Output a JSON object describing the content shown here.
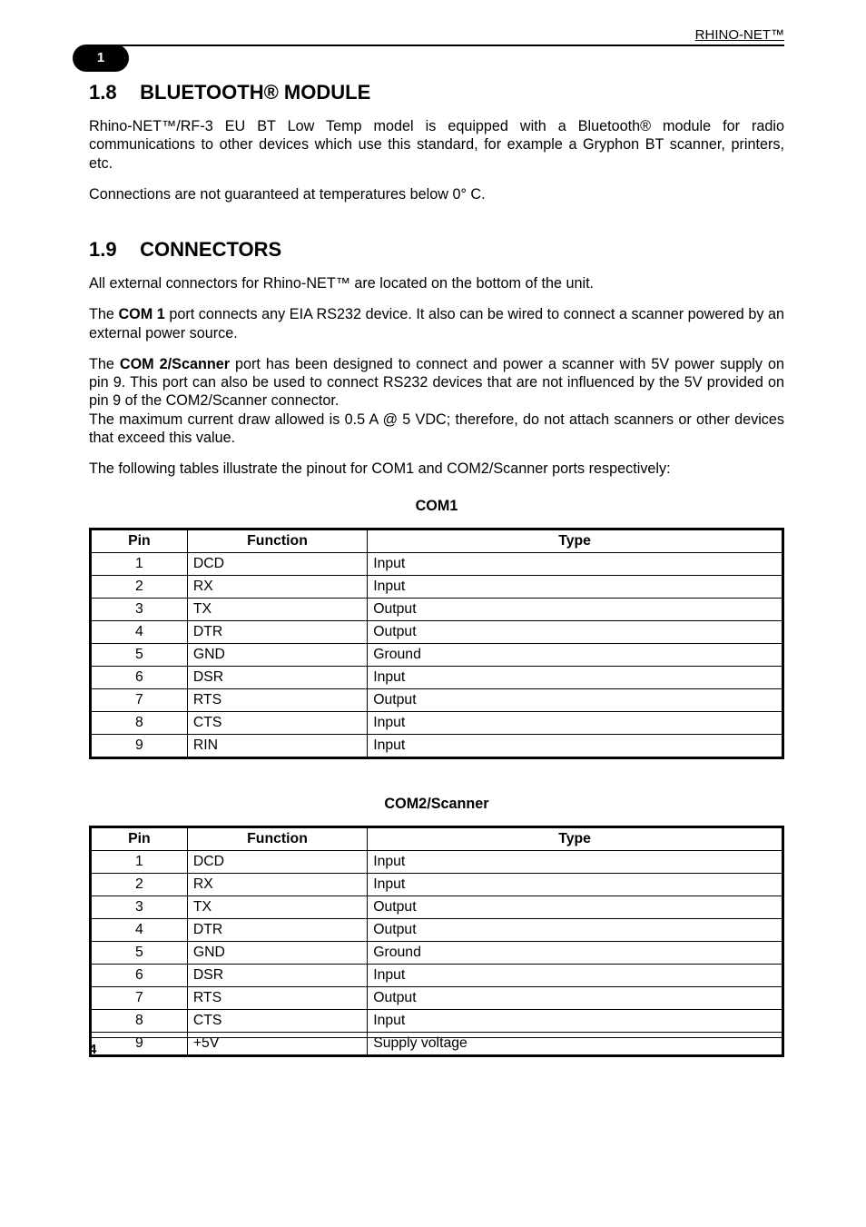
{
  "header": {
    "product": "RHINO-NET™",
    "chapter_badge": "1"
  },
  "sections": {
    "bluetooth": {
      "num": "1.8",
      "title": "BLUETOOTH® MODULE",
      "p1": "Rhino-NET™/RF-3 EU BT Low Temp model is equipped with a Bluetooth® module for radio communications to other devices which use this standard, for example a Gryphon BT scanner, printers, etc.",
      "p2": "Connections are not guaranteed at temperatures below 0° C."
    },
    "connectors": {
      "num": "1.9",
      "title": "CONNECTORS",
      "p1": "All external connectors for Rhino-NET™ are located on the bottom of the unit.",
      "p2a": "The ",
      "p2b_bold": "COM 1",
      "p2c": " port connects any EIA RS232 device. It also can be wired to connect a scanner powered by an external power source.",
      "p3a": "The ",
      "p3b_bold": "COM 2/Scanner",
      "p3c": " port has been designed to connect and power a scanner with 5V power supply on pin 9. This port can also be used to connect RS232 devices that are not influenced by the 5V provided on pin 9 of the COM2/Scanner connector.",
      "p4": "The maximum current draw allowed is 0.5 A @ 5 VDC; therefore, do not attach scanners or other devices that exceed this value.",
      "p5": "The following tables illustrate the pinout for COM1 and COM2/Scanner ports respectively:"
    }
  },
  "tables": {
    "com1": {
      "title": "COM1",
      "headers": {
        "pin": "Pin",
        "function": "Function",
        "type": "Type"
      },
      "rows": [
        {
          "pin": "1",
          "function": "DCD",
          "type": "Input"
        },
        {
          "pin": "2",
          "function": "RX",
          "type": "Input"
        },
        {
          "pin": "3",
          "function": "TX",
          "type": "Output"
        },
        {
          "pin": "4",
          "function": "DTR",
          "type": "Output"
        },
        {
          "pin": "5",
          "function": "GND",
          "type": "Ground"
        },
        {
          "pin": "6",
          "function": "DSR",
          "type": "Input"
        },
        {
          "pin": "7",
          "function": "RTS",
          "type": "Output"
        },
        {
          "pin": "8",
          "function": "CTS",
          "type": "Input"
        },
        {
          "pin": "9",
          "function": "RIN",
          "type": "Input"
        }
      ]
    },
    "com2": {
      "title": "COM2/Scanner",
      "headers": {
        "pin": "Pin",
        "function": "Function",
        "type": "Type"
      },
      "rows": [
        {
          "pin": "1",
          "function": "DCD",
          "type": "Input"
        },
        {
          "pin": "2",
          "function": "RX",
          "type": "Input"
        },
        {
          "pin": "3",
          "function": "TX",
          "type": "Output"
        },
        {
          "pin": "4",
          "function": "DTR",
          "type": "Output"
        },
        {
          "pin": "5",
          "function": "GND",
          "type": "Ground"
        },
        {
          "pin": "6",
          "function": "DSR",
          "type": "Input"
        },
        {
          "pin": "7",
          "function": "RTS",
          "type": "Output"
        },
        {
          "pin": "8",
          "function": "CTS",
          "type": "Input"
        },
        {
          "pin": "9",
          "function": "+5V",
          "type": "Supply voltage"
        }
      ]
    }
  },
  "footer": {
    "page": "4"
  }
}
